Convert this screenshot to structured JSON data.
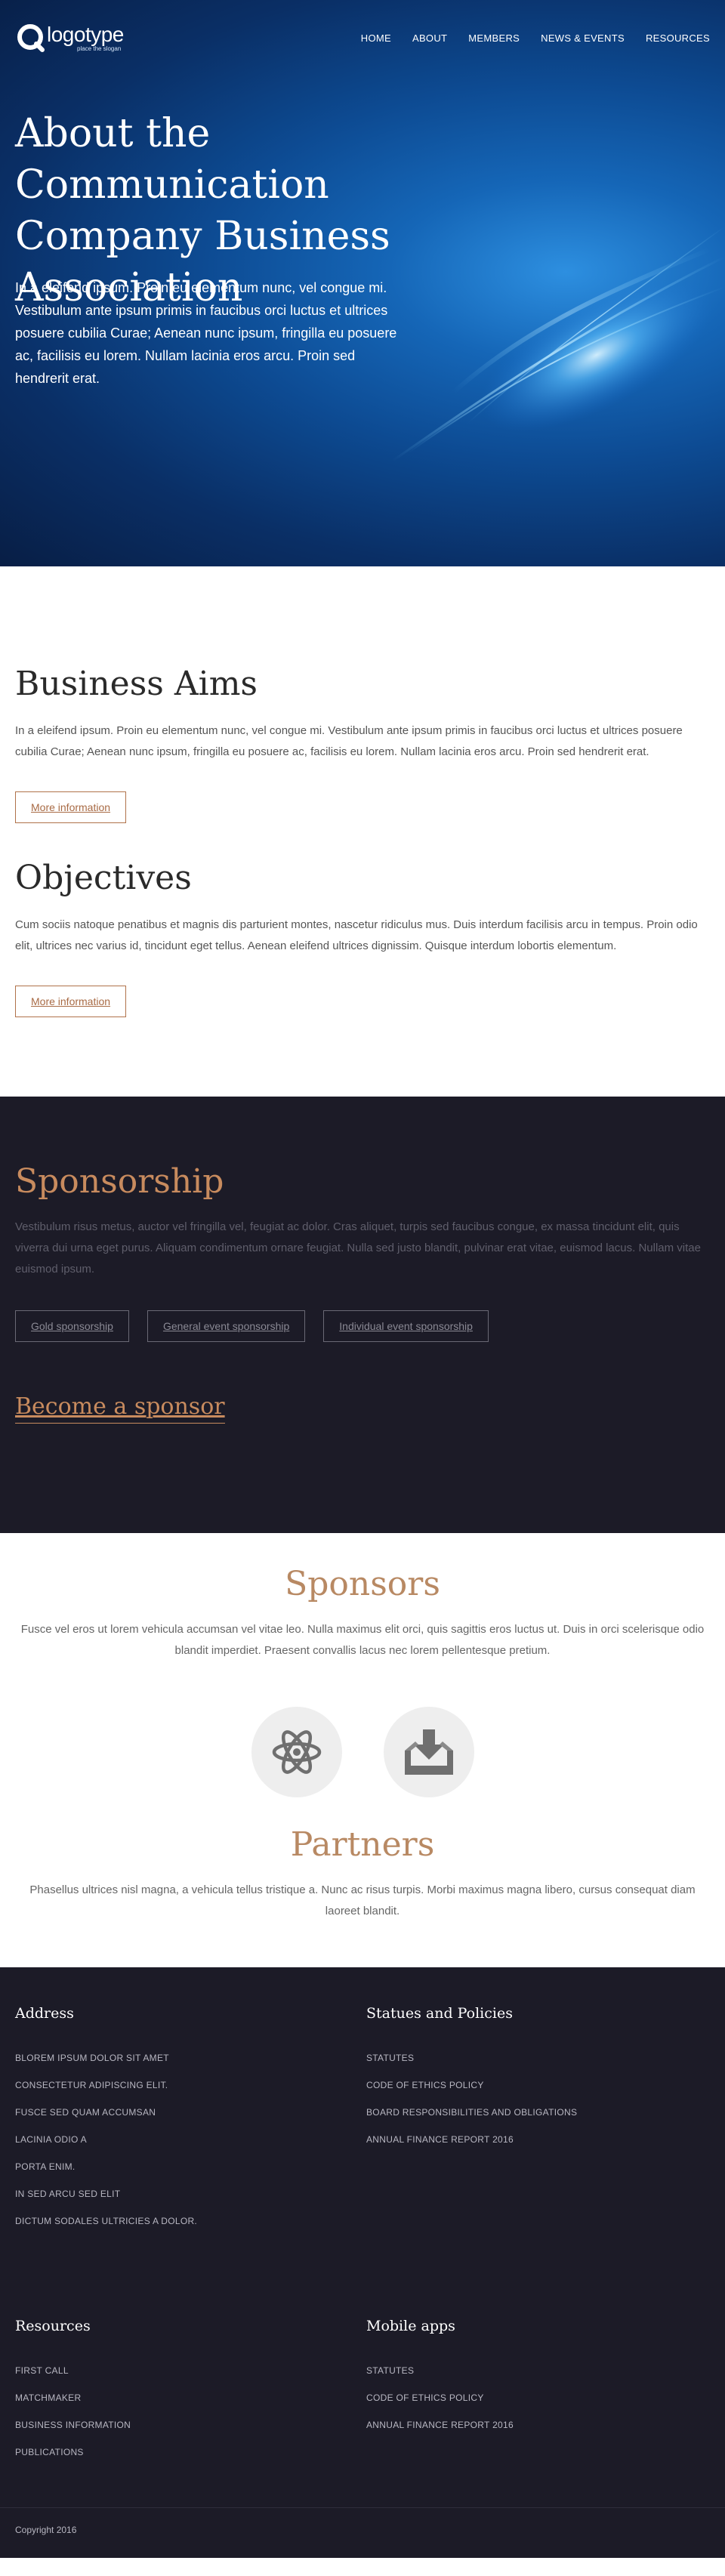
{
  "nav": {
    "logo_word": "logotype",
    "logo_slogan": "place the slogan",
    "items": [
      "HOME",
      "ABOUT",
      "MEMBERS",
      "NEWS & EVENTS",
      "RESOURCES"
    ]
  },
  "hero": {
    "title": "About the Communication Company Business Association",
    "text": "In a eleifend ipsum. Proin eu elementum nunc, vel congue mi. Vestibulum ante ipsum primis in faucibus orci luctus et ultrices posuere cubilia Curae; Aenean nunc ipsum, fringilla eu posuere ac, facilisis eu lorem. Nullam lacinia eros arcu. Proin sed hendrerit erat."
  },
  "aims": {
    "title": "Business Aims",
    "text": "In a eleifend ipsum. Proin eu elementum nunc, vel congue mi. Vestibulum ante ipsum primis in faucibus orci luctus et ultrices posuere cubilia Curae; Aenean nunc ipsum, fringilla eu posuere ac, facilisis eu lorem. Nullam lacinia eros arcu. Proin sed hendrerit erat.",
    "button": "More information"
  },
  "objectives": {
    "title": "Objectives",
    "text": "Cum sociis natoque penatibus et magnis dis parturient montes, nascetur ridiculus mus. Duis interdum facilisis arcu in tempus. Proin odio elit, ultrices nec varius id, tincidunt eget tellus. Aenean eleifend ultrices dignissim. Quisque interdum lobortis elementum.",
    "button": "More information"
  },
  "sponsorship": {
    "title": "Sponsorship",
    "text": "Vestibulum risus metus, auctor vel fringilla vel, feugiat ac dolor. Cras aliquet, turpis sed faucibus congue, ex massa tincidunt elit, quis viverra dui urna eget purus. Aliquam condimentum ornare feugiat. Nulla sed justo blandit, pulvinar erat vitae, euismod lacus. Nullam vitae euismod ipsum.",
    "buttons": [
      "Gold sponsorship",
      "General event sponsorship",
      "Individual event sponsorship"
    ],
    "link": "Become a sponsor"
  },
  "sponsors": {
    "title": "Sponsors",
    "text": "Fusce vel eros ut lorem vehicula accumsan vel vitae leo. Nulla maximus elit orci, quis sagittis eros luctus ut. Duis in orci scelerisque odio blandit imperdiet. Praesent convallis lacus nec lorem pellentesque pretium.",
    "icons": [
      "atom-icon",
      "download-tray-icon"
    ]
  },
  "partners": {
    "title": "Partners",
    "text": "Phasellus ultrices nisl magna, a vehicula tellus tristique a. Nunc ac risus turpis. Morbi maximus magna libero, cursus consequat diam laoreet blandit."
  },
  "footer": {
    "address": {
      "title": "Address",
      "lines": [
        "BLOREM IPSUM DOLOR SIT AMET",
        "CONSECTETUR ADIPISCING ELIT.",
        "FUSCE SED QUAM ACCUMSAN",
        "LACINIA ODIO A",
        "PORTA ENIM.",
        "IN SED ARCU SED ELIT",
        "DICTUM SODALES ULTRICIES A DOLOR."
      ]
    },
    "statutes": {
      "title": "Statues and Policies",
      "links": [
        "STATUTES",
        "CODE OF ETHICS POLICY",
        "BOARD RESPONSIBILITIES AND OBLIGATIONS",
        "ANNUAL FINANCE REPORT 2016"
      ]
    },
    "resources": {
      "title": "Resources",
      "links": [
        "FIRST CALL",
        "MATCHMAKER",
        "BUSINESS INFORMATION",
        "PUBLICATIONS"
      ]
    },
    "mobile": {
      "title": "Mobile apps",
      "links": [
        "STATUTES",
        "CODE OF ETHICS POLICY",
        "ANNUAL FINANCE REPORT 2016"
      ]
    },
    "copyright": "Copyright 2016"
  },
  "colors": {
    "accent": "#c88b5e",
    "dark_bg": "#1c1b27",
    "hero_blue": "#0d4b93"
  }
}
